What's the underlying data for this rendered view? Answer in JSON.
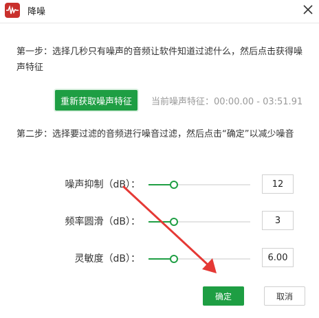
{
  "window": {
    "title": "降噪"
  },
  "step1": {
    "text": "第一步：选择几秒只有噪声的音频让软件知道过滤什么，然后点击获得噪声特征",
    "button_label": "重新获取噪声特征",
    "feature_text": "当前噪声特征：00:00.00 - 03:51.91"
  },
  "step2": {
    "text": "第二步：选择要过滤的音频进行噪音过滤，然后点击“确定”以减少噪音"
  },
  "sliders": [
    {
      "label": "噪声抑制（dB）：",
      "value": "12",
      "level": 0.25
    },
    {
      "label": "频率圆滑（dB）：",
      "value": "3",
      "level": 0.25
    },
    {
      "label": "灵敏度（dB）：",
      "value": "6.00",
      "level": 0.25
    }
  ],
  "footer": {
    "ok_label": "确定",
    "cancel_label": "取消"
  },
  "colors": {
    "accent": "#1e9e43",
    "annotation": "#e53935",
    "app_icon": "#c9302c"
  },
  "icons": {
    "app": "audio-waveform-icon",
    "close": "close-icon"
  }
}
